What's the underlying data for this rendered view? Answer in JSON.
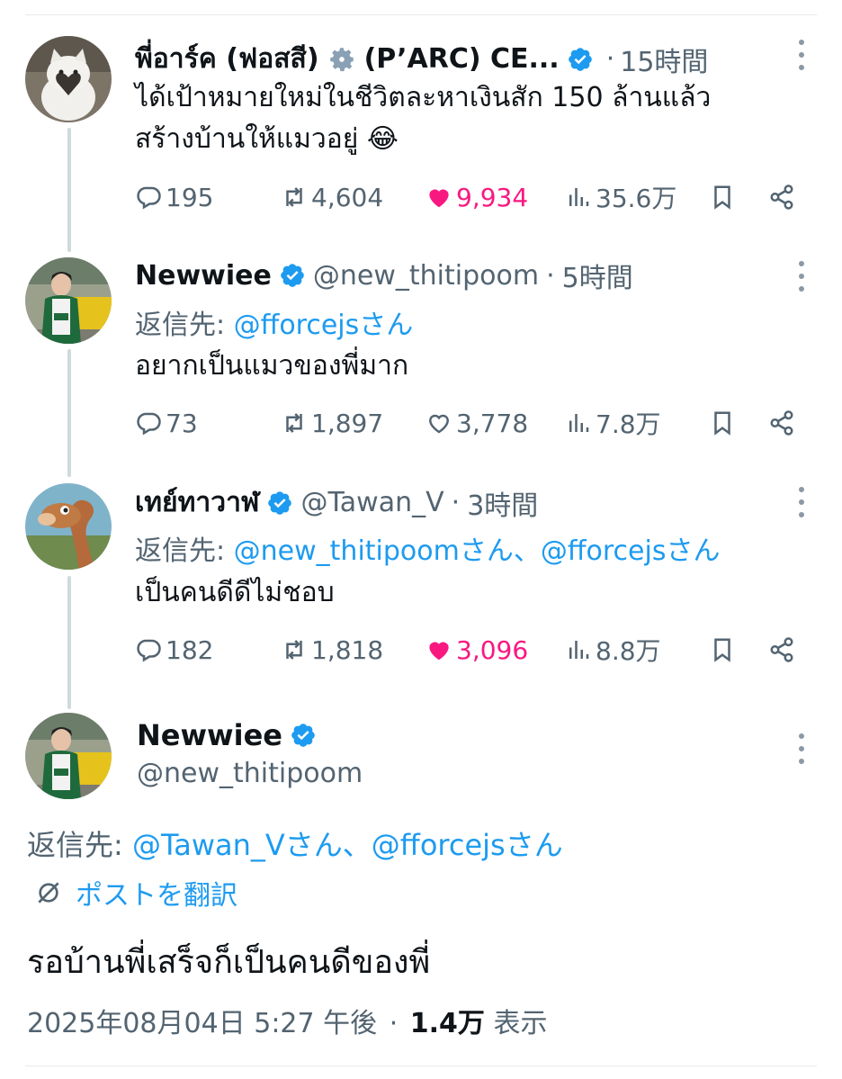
{
  "colors": {
    "accent": "#1d9bf0",
    "like": "#f91880",
    "muted": "#536471",
    "text": "#0f1419"
  },
  "tweets": [
    {
      "display_name": "พี่อาร์ค (ฟอสสี)",
      "name_suffix": "(P’ARC) CE...",
      "gear_icon": "gear-icon",
      "verified": true,
      "separator": "·",
      "time": "15時間",
      "lines": [
        "ได้เป้าหมายใหม่ในชีวิตละหาเงินสัก 150 ล้านแล้ว",
        "สร้างบ้านให้แมวอยู่ 😂"
      ],
      "replies": "195",
      "reposts": "4,604",
      "likes": "9,934",
      "liked": true,
      "views": "35.6万"
    },
    {
      "display_name": "Newwiee",
      "handle": "@new_thitipoom",
      "verified": true,
      "separator": "·",
      "time": "5時間",
      "reply_prefix": "返信先:",
      "reply_mentions": "@fforcejsさん",
      "lines": [
        "อยากเป็นแมวของพี่มาก"
      ],
      "replies": "73",
      "reposts": "1,897",
      "likes": "3,778",
      "liked": false,
      "views": "7.8万"
    },
    {
      "display_name": "เทย์ทาวาฬ",
      "handle": "@Tawan_V",
      "verified": true,
      "separator": "·",
      "time": "3時間",
      "reply_prefix": "返信先:",
      "reply_mentions": "@new_thitipoomさん、@fforcejsさん",
      "lines": [
        "เป็นคนดีดีไม่ชอบ"
      ],
      "replies": "182",
      "reposts": "1,818",
      "likes": "3,096",
      "liked": true,
      "views": "8.8万"
    }
  ],
  "main_tweet": {
    "display_name": "Newwiee",
    "handle": "@new_thitipoom",
    "reply_prefix": "返信先:",
    "reply_mentions": "@Tawan_Vさん、@fforcejsさん",
    "translate_label": "ポストを翻訳",
    "text": "รอบ้านพี่เสร็จก็เป็นคนดีของพี่",
    "timestamp": "2025年08月04日 5:27 午後",
    "separator": "·",
    "views_count": "1.4万",
    "views_label": "表示"
  }
}
